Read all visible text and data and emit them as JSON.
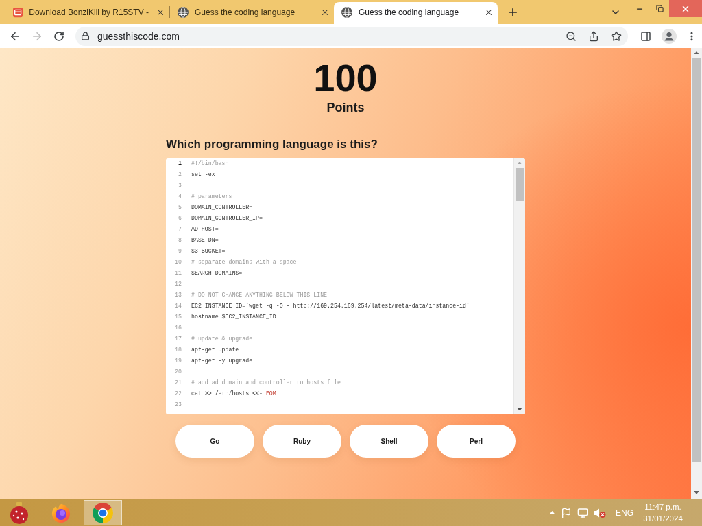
{
  "browser": {
    "tabs": [
      {
        "title": "Download BonziKill by R15STV -",
        "selected": false
      },
      {
        "title": "Guess the coding language",
        "selected": false
      },
      {
        "title": "Guess the coding language",
        "selected": true
      }
    ],
    "address": "guessthiscode.com"
  },
  "page": {
    "score": "100",
    "score_label": "Points",
    "question": "Which programming language is this?",
    "code_lines": [
      {
        "number": "1",
        "active": true,
        "tokens": [
          {
            "kind": "comment",
            "text": "#!/bin/bash"
          }
        ]
      },
      {
        "number": "2",
        "active": false,
        "tokens": [
          {
            "kind": "code",
            "text": "set -ex"
          }
        ]
      },
      {
        "number": "3",
        "active": false
      },
      {
        "number": "4",
        "active": false,
        "tokens": [
          {
            "kind": "comment",
            "text": "# parameters"
          }
        ]
      },
      {
        "number": "5",
        "active": false,
        "tokens": [
          {
            "kind": "code",
            "text": "DOMAIN_CONTROLLER="
          }
        ]
      },
      {
        "number": "6",
        "active": false,
        "tokens": [
          {
            "kind": "code",
            "text": "DOMAIN_CONTROLLER_IP="
          }
        ]
      },
      {
        "number": "7",
        "active": false,
        "tokens": [
          {
            "kind": "code",
            "text": "AD_HOST="
          }
        ]
      },
      {
        "number": "8",
        "active": false,
        "tokens": [
          {
            "kind": "code",
            "text": "BASE_DN="
          }
        ]
      },
      {
        "number": "9",
        "active": false,
        "tokens": [
          {
            "kind": "code",
            "text": "S3_BUCKET="
          }
        ]
      },
      {
        "number": "10",
        "active": false,
        "tokens": [
          {
            "kind": "comment",
            "text": "# separate domains with a space"
          }
        ]
      },
      {
        "number": "11",
        "active": false,
        "tokens": [
          {
            "kind": "code",
            "text": "SEARCH_DOMAINS="
          }
        ]
      },
      {
        "number": "12",
        "active": false
      },
      {
        "number": "13",
        "active": false,
        "tokens": [
          {
            "kind": "comment",
            "text": "# DO NOT CHANGE ANYTHING BELOW THIS LINE"
          }
        ]
      },
      {
        "number": "14",
        "active": false,
        "tokens": [
          {
            "kind": "code",
            "text": "EC2_INSTANCE_ID=`wget -q -O - http://169.254.169.254/latest/meta-data/instance-id`"
          }
        ]
      },
      {
        "number": "15",
        "active": false,
        "tokens": [
          {
            "kind": "code",
            "text": "hostname $EC2_INSTANCE_ID"
          }
        ]
      },
      {
        "number": "16",
        "active": false
      },
      {
        "number": "17",
        "active": false,
        "tokens": [
          {
            "kind": "comment",
            "text": "# update & upgrade"
          }
        ]
      },
      {
        "number": "18",
        "active": false,
        "tokens": [
          {
            "kind": "code",
            "text": "apt-get update"
          }
        ]
      },
      {
        "number": "19",
        "active": false,
        "tokens": [
          {
            "kind": "code",
            "text": "apt-get -y upgrade"
          }
        ]
      },
      {
        "number": "20",
        "active": false
      },
      {
        "number": "21",
        "active": false,
        "tokens": [
          {
            "kind": "comment",
            "text": "# add ad domain and controller to hosts file"
          }
        ]
      },
      {
        "number": "22",
        "active": false,
        "tokens": [
          {
            "kind": "code",
            "text": "cat >> /etc/hosts <<- "
          },
          {
            "kind": "string",
            "text": "EOM"
          }
        ]
      },
      {
        "number": "23",
        "active": false
      }
    ],
    "answers": [
      "Go",
      "Ruby",
      "Shell",
      "Perl"
    ]
  },
  "taskbar": {
    "apps": [
      {
        "selected": false
      },
      {
        "selected": false
      },
      {
        "selected": true
      }
    ],
    "language": "ENG",
    "time": "11:47 p.m.",
    "date": "31/01/2024"
  }
}
